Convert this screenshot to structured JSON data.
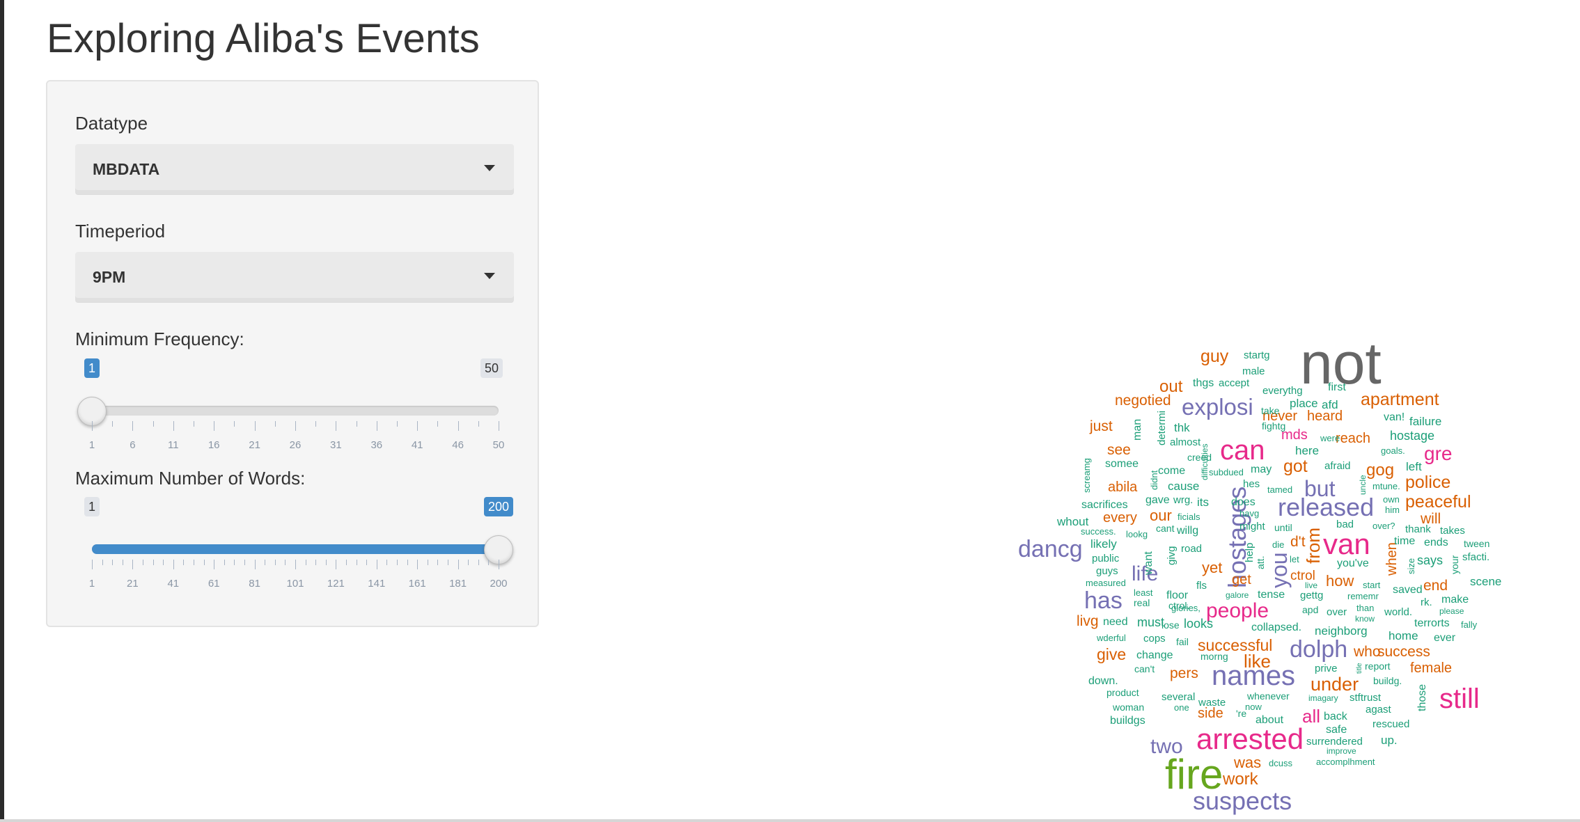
{
  "page": {
    "title": "Exploring Aliba's Events"
  },
  "controls": {
    "datatype": {
      "label": "Datatype",
      "selected": "MBDATA"
    },
    "timeperiod": {
      "label": "Timeperiod",
      "selected": "9PM"
    },
    "min_frequency": {
      "label": "Minimum Frequency:",
      "min": 1,
      "max": 50,
      "value": 1,
      "min_label": "1",
      "max_label": "50",
      "value_label": "1",
      "tick_labels": [
        "1",
        "6",
        "11",
        "16",
        "21",
        "26",
        "31",
        "36",
        "41",
        "46",
        "50"
      ]
    },
    "max_words": {
      "label": "Maximum Number of Words:",
      "min": 1,
      "max": 200,
      "value": 200,
      "min_label": "1",
      "max_label": "200",
      "value_label": "200",
      "tick_labels": [
        "1",
        "21",
        "41",
        "61",
        "81",
        "101",
        "121",
        "141",
        "161",
        "181",
        "200"
      ]
    }
  },
  "colors": {
    "slider_accent": "#428bca",
    "palette_gray": "#666666",
    "palette_orange": "#d95f02",
    "palette_purple": "#7570b3",
    "palette_pink": "#e7298a",
    "palette_green": "#66a61e",
    "palette_teal": "#1b9e77"
  },
  "wordcloud": {
    "words": [
      {
        "text": "not",
        "c": "gray"
      },
      {
        "text": "fire",
        "c": "green"
      },
      {
        "text": "arrested",
        "c": "pink"
      },
      {
        "text": "van",
        "c": "pink"
      },
      {
        "text": "names",
        "c": "purple"
      },
      {
        "text": "hostages",
        "c": "purple"
      },
      {
        "text": "can",
        "c": "pink"
      },
      {
        "text": "released",
        "c": "purple"
      },
      {
        "text": "still",
        "c": "pink"
      },
      {
        "text": "suspects",
        "c": "purple"
      },
      {
        "text": "dancg",
        "c": "purple"
      },
      {
        "text": "dolph",
        "c": "purple"
      },
      {
        "text": "has",
        "c": "purple"
      },
      {
        "text": "explosi",
        "c": "purple"
      },
      {
        "text": "people",
        "c": "pink"
      },
      {
        "text": "two",
        "c": "purple"
      },
      {
        "text": "but",
        "c": "purple"
      },
      {
        "text": "you",
        "c": "purple"
      },
      {
        "text": "life",
        "c": "purple"
      },
      {
        "text": "apartment",
        "c": "orange"
      },
      {
        "text": "peaceful",
        "c": "orange"
      },
      {
        "text": "police",
        "c": "orange"
      },
      {
        "text": "gre",
        "c": "pink"
      },
      {
        "text": "guy",
        "c": "orange"
      },
      {
        "text": "under",
        "c": "orange"
      },
      {
        "text": "successful",
        "c": "orange"
      },
      {
        "text": "like",
        "c": "orange"
      },
      {
        "text": "work",
        "c": "orange"
      },
      {
        "text": "was",
        "c": "orange"
      },
      {
        "text": "all",
        "c": "pink"
      },
      {
        "text": "from",
        "c": "orange"
      },
      {
        "text": "got",
        "c": "orange"
      },
      {
        "text": "gog",
        "c": "orange"
      },
      {
        "text": "negotied",
        "c": "orange"
      },
      {
        "text": "out",
        "c": "orange"
      },
      {
        "text": "never",
        "c": "orange"
      },
      {
        "text": "heard",
        "c": "orange"
      },
      {
        "text": "mds",
        "c": "pink"
      },
      {
        "text": "reach",
        "c": "orange"
      },
      {
        "text": "just",
        "c": "orange"
      },
      {
        "text": "see",
        "c": "orange"
      },
      {
        "text": "abila",
        "c": "orange"
      },
      {
        "text": "every",
        "c": "orange"
      },
      {
        "text": "our",
        "c": "orange"
      },
      {
        "text": "yet",
        "c": "orange"
      },
      {
        "text": "get",
        "c": "orange"
      },
      {
        "text": "how",
        "c": "orange"
      },
      {
        "text": "d't",
        "c": "orange"
      },
      {
        "text": "ctrol",
        "c": "orange"
      },
      {
        "text": "end",
        "c": "orange"
      },
      {
        "text": "will",
        "c": "orange"
      },
      {
        "text": "give",
        "c": "orange"
      },
      {
        "text": "pers",
        "c": "orange"
      },
      {
        "text": "who",
        "c": "orange"
      },
      {
        "text": "success",
        "c": "orange"
      },
      {
        "text": "female",
        "c": "orange"
      },
      {
        "text": "side",
        "c": "orange"
      },
      {
        "text": "livg",
        "c": "orange"
      },
      {
        "text": "when",
        "c": "orange"
      },
      {
        "text": "says",
        "c": "teal"
      },
      {
        "text": "startg",
        "c": "teal"
      },
      {
        "text": "male",
        "c": "teal"
      },
      {
        "text": "thgs",
        "c": "teal"
      },
      {
        "text": "accept",
        "c": "teal"
      },
      {
        "text": "everythg",
        "c": "teal"
      },
      {
        "text": "first",
        "c": "teal"
      },
      {
        "text": "place",
        "c": "teal"
      },
      {
        "text": "afd",
        "c": "teal"
      },
      {
        "text": "take",
        "c": "teal"
      },
      {
        "text": "van!",
        "c": "teal"
      },
      {
        "text": "failure",
        "c": "teal"
      },
      {
        "text": "hostage",
        "c": "teal"
      },
      {
        "text": "thk",
        "c": "teal"
      },
      {
        "text": "fightg",
        "c": "teal"
      },
      {
        "text": "man",
        "c": "teal"
      },
      {
        "text": "determi",
        "c": "teal"
      },
      {
        "text": "almost",
        "c": "teal"
      },
      {
        "text": "here",
        "c": "teal"
      },
      {
        "text": "were",
        "c": "teal"
      },
      {
        "text": "goals.",
        "c": "teal"
      },
      {
        "text": "left",
        "c": "teal"
      },
      {
        "text": "creed",
        "c": "teal"
      },
      {
        "text": "difficulties",
        "c": "teal"
      },
      {
        "text": "somee",
        "c": "teal"
      },
      {
        "text": "come",
        "c": "teal"
      },
      {
        "text": "subdued",
        "c": "teal"
      },
      {
        "text": "may",
        "c": "teal"
      },
      {
        "text": "afraid",
        "c": "teal"
      },
      {
        "text": "screamg",
        "c": "teal"
      },
      {
        "text": "didnt",
        "c": "teal"
      },
      {
        "text": "cause",
        "c": "teal"
      },
      {
        "text": "hes",
        "c": "teal"
      },
      {
        "text": "tamed",
        "c": "teal"
      },
      {
        "text": "uncle",
        "c": "teal"
      },
      {
        "text": "mtune.",
        "c": "teal"
      },
      {
        "text": "sacrifices",
        "c": "teal"
      },
      {
        "text": "gave",
        "c": "teal"
      },
      {
        "text": "wrg.",
        "c": "teal"
      },
      {
        "text": "its",
        "c": "teal"
      },
      {
        "text": "does",
        "c": "teal"
      },
      {
        "text": "own",
        "c": "teal"
      },
      {
        "text": "him",
        "c": "teal"
      },
      {
        "text": "whout",
        "c": "teal"
      },
      {
        "text": "ficials",
        "c": "teal"
      },
      {
        "text": "havg",
        "c": "teal"
      },
      {
        "text": "bad",
        "c": "teal"
      },
      {
        "text": "over?",
        "c": "teal"
      },
      {
        "text": "thank",
        "c": "teal"
      },
      {
        "text": "takes",
        "c": "teal"
      },
      {
        "text": "success.",
        "c": "teal"
      },
      {
        "text": "lookg",
        "c": "teal"
      },
      {
        "text": "cant",
        "c": "teal"
      },
      {
        "text": "willg",
        "c": "teal"
      },
      {
        "text": "might",
        "c": "teal"
      },
      {
        "text": "until",
        "c": "teal"
      },
      {
        "text": "time",
        "c": "teal"
      },
      {
        "text": "ends",
        "c": "teal"
      },
      {
        "text": "tween",
        "c": "teal"
      },
      {
        "text": "likely",
        "c": "teal"
      },
      {
        "text": "givg",
        "c": "teal"
      },
      {
        "text": "road",
        "c": "teal"
      },
      {
        "text": "help",
        "c": "teal"
      },
      {
        "text": "die",
        "c": "teal"
      },
      {
        "text": "size",
        "c": "teal"
      },
      {
        "text": "your",
        "c": "teal"
      },
      {
        "text": "sfacti.",
        "c": "teal"
      },
      {
        "text": "public",
        "c": "teal"
      },
      {
        "text": "want",
        "c": "teal"
      },
      {
        "text": "att.",
        "c": "teal"
      },
      {
        "text": "let",
        "c": "teal"
      },
      {
        "text": "you've",
        "c": "teal"
      },
      {
        "text": "guys",
        "c": "teal"
      },
      {
        "text": "scene",
        "c": "teal"
      },
      {
        "text": "measured",
        "c": "teal"
      },
      {
        "text": "fls",
        "c": "teal"
      },
      {
        "text": "live",
        "c": "teal"
      },
      {
        "text": "start",
        "c": "teal"
      },
      {
        "text": "saved",
        "c": "teal"
      },
      {
        "text": "least",
        "c": "teal"
      },
      {
        "text": "floor",
        "c": "teal"
      },
      {
        "text": "galore",
        "c": "teal"
      },
      {
        "text": "tense",
        "c": "teal"
      },
      {
        "text": "gettg",
        "c": "teal"
      },
      {
        "text": "rememr",
        "c": "teal"
      },
      {
        "text": "rk.",
        "c": "teal"
      },
      {
        "text": "make",
        "c": "teal"
      },
      {
        "text": "real",
        "c": "teal"
      },
      {
        "text": "ctrol.",
        "c": "teal"
      },
      {
        "text": "glories,",
        "c": "teal"
      },
      {
        "text": "apd",
        "c": "teal"
      },
      {
        "text": "over",
        "c": "teal"
      },
      {
        "text": "than",
        "c": "teal"
      },
      {
        "text": "world.",
        "c": "teal"
      },
      {
        "text": "please",
        "c": "teal"
      },
      {
        "text": "need",
        "c": "teal"
      },
      {
        "text": "must",
        "c": "teal"
      },
      {
        "text": "lose",
        "c": "teal"
      },
      {
        "text": "looks",
        "c": "teal"
      },
      {
        "text": "know",
        "c": "teal"
      },
      {
        "text": "terrorts",
        "c": "teal"
      },
      {
        "text": "fally",
        "c": "teal"
      },
      {
        "text": "collapsed.",
        "c": "teal"
      },
      {
        "text": "neighborg",
        "c": "teal"
      },
      {
        "text": "home",
        "c": "teal"
      },
      {
        "text": "ever",
        "c": "teal"
      },
      {
        "text": "wderful",
        "c": "teal"
      },
      {
        "text": "cops",
        "c": "teal"
      },
      {
        "text": "fail",
        "c": "teal"
      },
      {
        "text": "change",
        "c": "teal"
      },
      {
        "text": "morng",
        "c": "teal"
      },
      {
        "text": "can't",
        "c": "teal"
      },
      {
        "text": "prive",
        "c": "teal"
      },
      {
        "text": "title",
        "c": "teal"
      },
      {
        "text": "report",
        "c": "teal"
      },
      {
        "text": "down.",
        "c": "teal"
      },
      {
        "text": "buildg.",
        "c": "teal"
      },
      {
        "text": "product",
        "c": "teal"
      },
      {
        "text": "several",
        "c": "teal"
      },
      {
        "text": "whenever",
        "c": "teal"
      },
      {
        "text": "imagary",
        "c": "teal"
      },
      {
        "text": "stftrust",
        "c": "teal"
      },
      {
        "text": "those",
        "c": "teal"
      },
      {
        "text": "woman",
        "c": "teal"
      },
      {
        "text": "one",
        "c": "teal"
      },
      {
        "text": "waste",
        "c": "teal"
      },
      {
        "text": "'re",
        "c": "teal"
      },
      {
        "text": "now",
        "c": "teal"
      },
      {
        "text": "agast",
        "c": "teal"
      },
      {
        "text": "buildgs",
        "c": "teal"
      },
      {
        "text": "about",
        "c": "teal"
      },
      {
        "text": "back",
        "c": "teal"
      },
      {
        "text": "rescued",
        "c": "teal"
      },
      {
        "text": "safe",
        "c": "teal"
      },
      {
        "text": "surrendered",
        "c": "teal"
      },
      {
        "text": "up.",
        "c": "teal"
      },
      {
        "text": "improve",
        "c": "teal"
      },
      {
        "text": "dcuss",
        "c": "teal"
      },
      {
        "text": "accomplhment",
        "c": "teal"
      }
    ]
  }
}
